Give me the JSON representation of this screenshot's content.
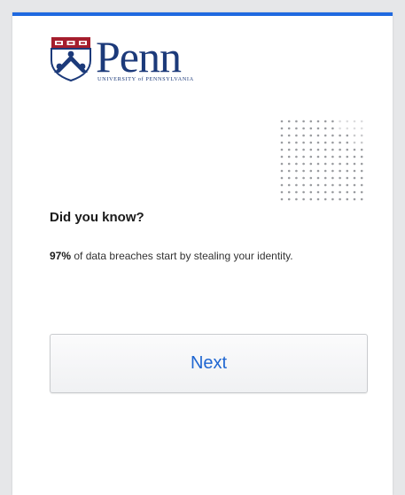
{
  "brand": {
    "wordmark": "Penn",
    "subline": "UNIVERSITY of PENNSYLVANIA",
    "accent_color": "#1f69e0",
    "logo_color": "#1c3a7a",
    "shield_icon": "penn-shield-icon"
  },
  "content": {
    "heading": "Did you know?",
    "stat": "97%",
    "message": " of data breaches start by stealing your identity.",
    "decoration": "dot-grid-icon"
  },
  "actions": {
    "next_label": "Next",
    "next_color": "#1f66d1"
  }
}
